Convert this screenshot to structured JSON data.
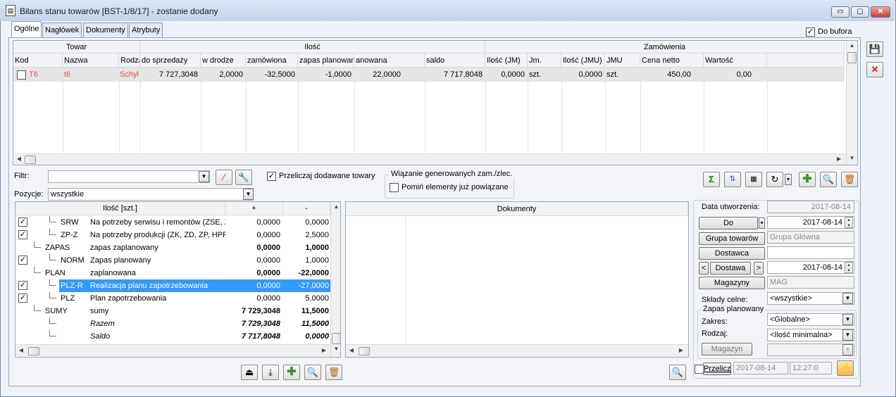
{
  "window": {
    "title": "Bilans stanu towarów [BST-1/8/17] - zostanie dodany",
    "min": "▭",
    "max": "▢",
    "close": "✕"
  },
  "tabs": [
    "Ogólne",
    "Nagłówek",
    "Dokumenty",
    "Atrybuty"
  ],
  "do_bufora": {
    "label": "Do bufora",
    "checked": true
  },
  "grid": {
    "group_headers": {
      "towar": "Towar",
      "ilosc": "Ilość",
      "zamowienia": "Zamówienia"
    },
    "columns": [
      "Kod",
      "Nazwa",
      "Rodza",
      "do sprzedaży",
      "w drodze",
      "zamówiona",
      "zapas planowan",
      "anowana",
      "saldo",
      "Ilość (JM)",
      "Jm.",
      "Ilość (JMU)",
      "JMU",
      "Cena netto",
      "Wartość"
    ],
    "rows": [
      {
        "kod": "T6",
        "nazwa": "t6",
        "rodzaj": "Schył",
        "do_sprzedazy": "7 727,3048",
        "w_drodze": "2,0000",
        "zamowiona": "-32,5000",
        "zapas": "-1,0000",
        "planowana": "22,0000",
        "saldo": "7 717,8048",
        "ilosc_jm": "0,0000",
        "jm": "szt.",
        "ilosc_jmu": "0,0000",
        "jmu": "szt.",
        "cena": "450,00",
        "wartosc": "0,00"
      }
    ]
  },
  "filtr": {
    "label": "Filtr:",
    "value": ""
  },
  "pozycje": {
    "label": "Pozycje:",
    "value": "wszystkie"
  },
  "przeliczaj": {
    "label": "Przeliczaj dodawane towary",
    "checked": true
  },
  "wiazanie": {
    "title": "Wiązanie generowanych zam./zlec.",
    "pomin_label": "Pomiń elementy już powiązane",
    "checked": false
  },
  "tree": {
    "headers": {
      "ilosc": "Ilość [szt.]",
      "plus": "+",
      "minus": "-"
    },
    "rows": [
      {
        "code": "SRW",
        "desc": "Na potrzeby serwisu i remontów (ZSE, Z",
        "plus": "0,0000",
        "minus": "0,0000",
        "checked": true,
        "indent": 2,
        "bold": false,
        "italic": false
      },
      {
        "code": "ZP-Z",
        "desc": "Na potrzeby produkcji (ZK, ZD, ZP, HPR)",
        "plus": "0,0000",
        "minus": "2,5000",
        "checked": true,
        "indent": 2,
        "bold": false,
        "italic": false
      },
      {
        "code": "ZAPAS",
        "desc": "zapas zaplanowany",
        "plus": "0,0000",
        "minus": "1,0000",
        "checked": false,
        "indent": 1,
        "bold": true,
        "italic": false
      },
      {
        "code": "NORM",
        "desc": "Zapas planowany",
        "plus": "0,0000",
        "minus": "1,0000",
        "checked": true,
        "indent": 2,
        "bold": false,
        "italic": false
      },
      {
        "code": "PLAN",
        "desc": "zaplanowana",
        "plus": "0,0000",
        "minus": "-22,0000",
        "checked": false,
        "indent": 1,
        "bold": true,
        "italic": false
      },
      {
        "code": "PLZ-R",
        "desc": "Realizacja planu zapotrzebowania",
        "plus": "0,0000",
        "minus": "-27,0000",
        "checked": true,
        "indent": 2,
        "bold": false,
        "italic": false,
        "selected": true
      },
      {
        "code": "PLZ",
        "desc": "Plan zapotrzebowania",
        "plus": "0,0000",
        "minus": "5,0000",
        "checked": true,
        "indent": 2,
        "bold": false,
        "italic": false
      },
      {
        "code": "SUMY",
        "desc": "sumy",
        "plus": "7 729,3048",
        "minus": "11,5000",
        "checked": false,
        "indent": 1,
        "bold": true,
        "italic": false
      },
      {
        "code": "",
        "desc": "Razem",
        "plus": "7 729,3048",
        "minus": "11,5000",
        "checked": false,
        "indent": 2,
        "bold": true,
        "italic": true
      },
      {
        "code": "",
        "desc": "Saldo",
        "plus": "7 717,8048",
        "minus": "0,0000",
        "checked": false,
        "indent": 2,
        "bold": true,
        "italic": true
      }
    ]
  },
  "docs": {
    "header": "Dokumenty"
  },
  "right": {
    "data_utworzenia": {
      "label": "Data utworzenia:",
      "value": "2017-08-14"
    },
    "do": {
      "label": "Do",
      "value": "2017-08-14"
    },
    "grupa": {
      "label": "Grupa towarów",
      "value": "Grupa Główna"
    },
    "dostawca": {
      "label": "Dostawca",
      "value": ""
    },
    "dostawa": {
      "label": "Dostawa",
      "prev": "<",
      "next": ">",
      "value": "2017-08-14"
    },
    "magazyny": {
      "label": "Magazyny",
      "value": "MAG"
    },
    "sklady": {
      "label": "Składy celne:",
      "value": "<wszystkie>"
    },
    "zapas": {
      "title": "Zapas planowany",
      "zakres_label": "Zakres:",
      "zakres": "<Globalne>",
      "rodzaj_label": "Rodzaj:",
      "rodzaj": "<Ilość minimalna>",
      "magazyn_label": "Magazyn",
      "magazyn": ""
    },
    "przelicz": {
      "label": "Przelicz",
      "date": "2017-08-14",
      "time": "12:27:0"
    }
  }
}
